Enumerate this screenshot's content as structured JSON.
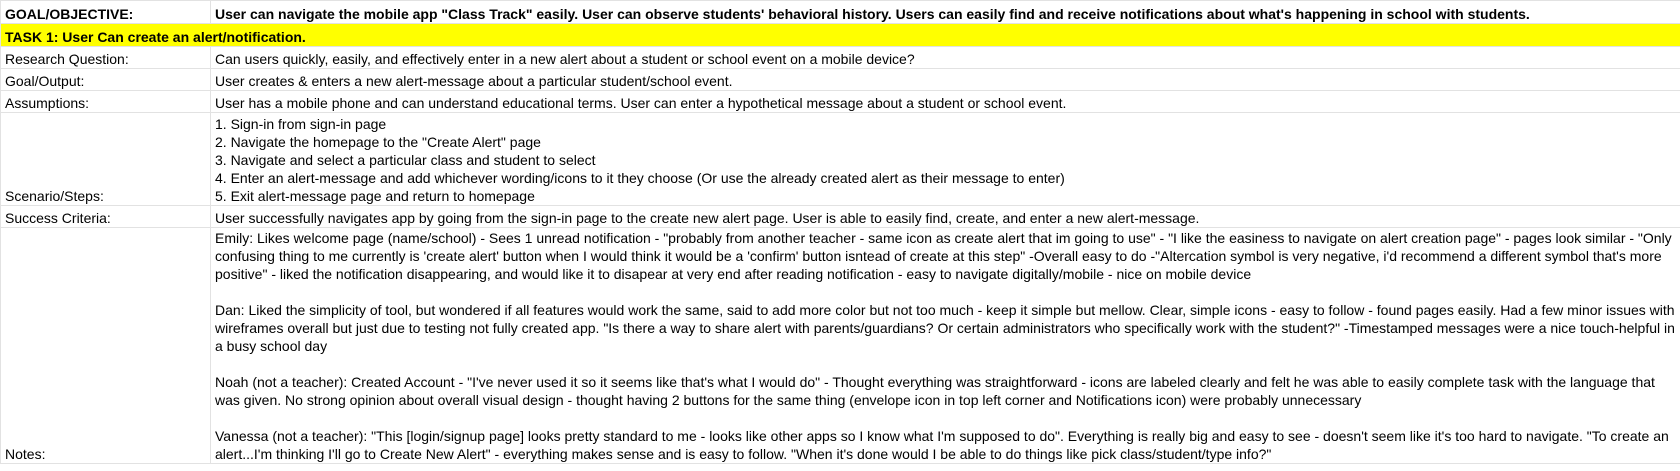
{
  "header": {
    "goal_label": "GOAL/OBJECTIVE:",
    "goal_text": "User can navigate the mobile app \"Class Track\" easily. User can observe students' behavioral history. Users can easily find and receive notifications about what's happening in school with students."
  },
  "task": {
    "title": "TASK 1: User Can create an alert/notification."
  },
  "rows": {
    "research": {
      "label": "Research Question:",
      "value": "Can users quickly, easily, and effectively enter in a new alert about a student or school event on a mobile device?"
    },
    "goal_output": {
      "label": "Goal/Output:",
      "value": "User creates & enters a new alert-message about a particular student/school event."
    },
    "assumptions": {
      "label": "Assumptions:",
      "value": "User has a mobile phone and can understand educational terms. User can enter a hypothetical message about a student or school event."
    },
    "scenario": {
      "label": "Scenario/Steps:",
      "steps": [
        "1. Sign-in from sign-in page",
        "2. Navigate the homepage to the \"Create Alert\" page",
        "3. Navigate and select a particular class and student to select",
        "4. Enter an alert-message and add whichever wording/icons to it they choose (Or use the already created alert as their message to enter)",
        "5. Exit alert-message page and return to homepage"
      ]
    },
    "success": {
      "label": "Success Criteria:",
      "value": "User successfully navigates app by going from the sign-in page to the create new alert page. User is able to easily find, create, and enter a new alert-message."
    },
    "notes": {
      "label": "Notes:",
      "entries": [
        "Emily: Likes welcome page (name/school) - Sees 1 unread notification - \"probably from another teacher - same icon as create alert that im going to use\" - \"I like the easiness to navigate on alert creation page\" - pages look similar - \"Only confusing thing to me currently is 'create alert' button when  I would think it would be a 'confirm' button isntead of create at this step\" -Overall easy to do -\"Altercation symbol is very negative, i'd recommend a different symbol that's more positive\" - liked the notification disappearing, and would like it to disapear at very end after reading notification - easy to navigate digitally/mobile - nice on mobile device",
        "Dan: Liked the simplicity of tool, but wondered if all features would work the same, said to add more color but not too much - keep it simple but mellow. Clear, simple icons - easy to follow - found pages easily. Had a few minor issues with wireframes overall but just due to testing not fully created app. \"Is there a way to share alert with parents/guardians? Or certain administrators who specifically work with the student?\" -Timestamped messages were a nice touch-helpful in a busy school day",
        "Noah (not a teacher): Created Account - \"I've never used it so it seems like that's what I would do\" - Thought everything was straightforward - icons are labeled clearly and felt he was able to easily complete task with the language that was given. No strong opinion about overall visual design - thought having 2 buttons for the same thing (envelope icon in top left corner and Notifications icon) were probably unnecessary",
        "Vanessa (not a teacher): \"This [login/signup page] looks pretty standard to me - looks like other apps so I know what I'm supposed to do\". Everything is really big and easy to see - doesn't seem like it's too hard to navigate. \"To create an alert...I'm thinking I'll go to Create New Alert\" - everything makes sense and is easy to follow. \"When it's done would I be able to do things like pick class/student/type info?\""
      ]
    }
  }
}
